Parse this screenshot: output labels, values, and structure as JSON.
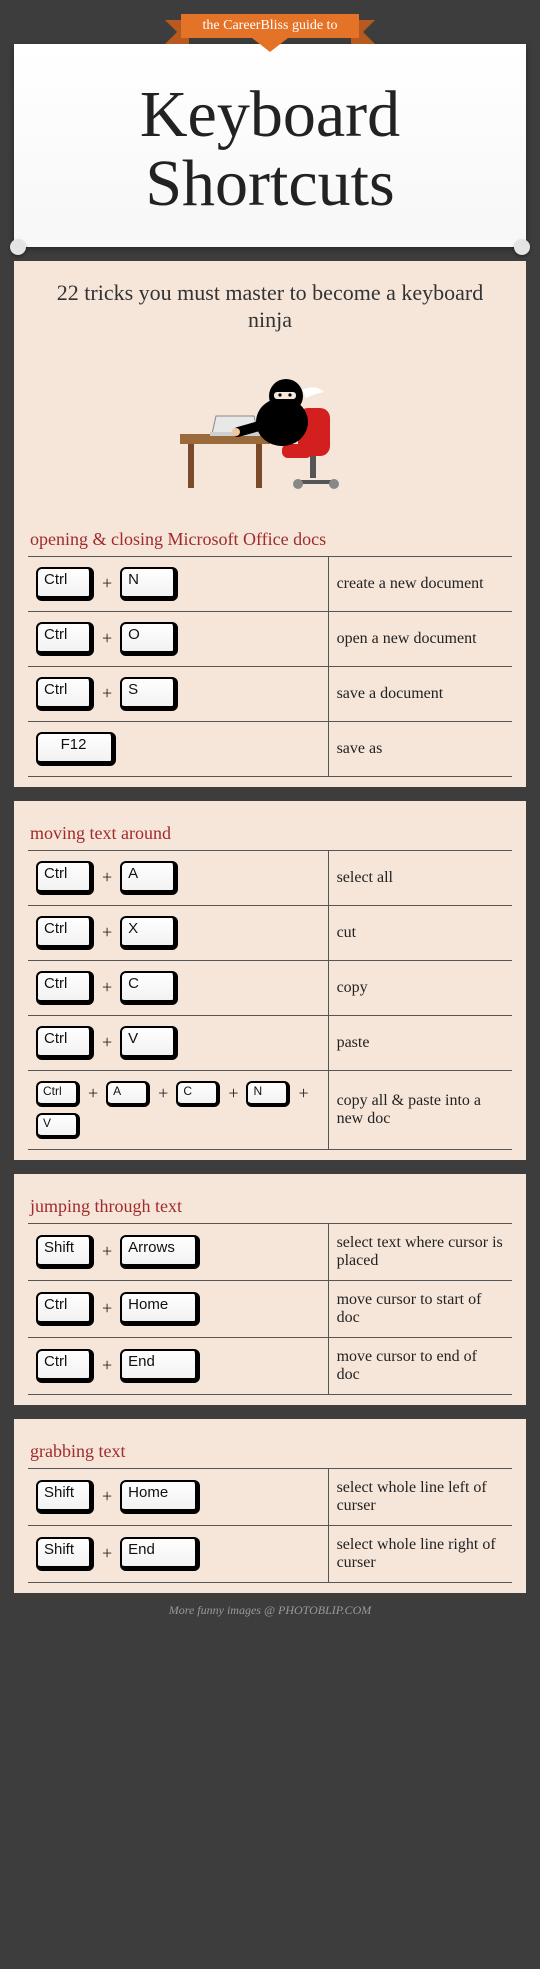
{
  "ribbon": "the CareerBliss guide to",
  "title_l1": "Keyboard",
  "title_l2": "Shortcuts",
  "subtitle": "22 tricks you must master to become a keyboard ninja",
  "sections": [
    {
      "title": "opening & closing Microsoft Office docs",
      "rows": [
        {
          "keys": [
            [
              "Ctrl"
            ],
            "+",
            [
              "N"
            ]
          ],
          "desc": "create a new document"
        },
        {
          "keys": [
            [
              "Ctrl"
            ],
            "+",
            [
              "O"
            ]
          ],
          "desc": "open a new document"
        },
        {
          "keys": [
            [
              "Ctrl"
            ],
            "+",
            [
              "S"
            ]
          ],
          "desc": "save a document"
        },
        {
          "keys": [
            [
              "F12",
              "wide center"
            ]
          ],
          "desc": "save as"
        }
      ]
    },
    {
      "title": "moving text around",
      "rows": [
        {
          "keys": [
            [
              "Ctrl"
            ],
            "+",
            [
              "A"
            ]
          ],
          "desc": "select all"
        },
        {
          "keys": [
            [
              "Ctrl"
            ],
            "+",
            [
              "X"
            ]
          ],
          "desc": "cut"
        },
        {
          "keys": [
            [
              "Ctrl"
            ],
            "+",
            [
              "C"
            ]
          ],
          "desc": "copy"
        },
        {
          "keys": [
            [
              "Ctrl"
            ],
            "+",
            [
              "V"
            ]
          ],
          "desc": "paste"
        },
        {
          "keys": [
            [
              "Ctrl",
              "small"
            ],
            "+",
            [
              "A",
              "small"
            ],
            "+",
            [
              "C",
              "small"
            ],
            "+",
            [
              "N",
              "small"
            ],
            "+",
            [
              "V",
              "small"
            ]
          ],
          "desc": "copy all & paste into a new doc"
        }
      ]
    },
    {
      "title": "jumping through text",
      "rows": [
        {
          "keys": [
            [
              "Shift"
            ],
            "+",
            [
              "Arrows",
              "wide"
            ]
          ],
          "desc": "select text where cursor is placed"
        },
        {
          "keys": [
            [
              "Ctrl"
            ],
            "+",
            [
              "Home",
              "wide"
            ]
          ],
          "desc": "move cursor to start of doc"
        },
        {
          "keys": [
            [
              "Ctrl"
            ],
            "+",
            [
              "End",
              "wide"
            ]
          ],
          "desc": "move cursor to end of doc"
        }
      ]
    },
    {
      "title": "grabbing text",
      "rows": [
        {
          "keys": [
            [
              "Shift"
            ],
            "+",
            [
              "Home",
              "wide"
            ]
          ],
          "desc": "select whole line left of curser"
        },
        {
          "keys": [
            [
              "Shift"
            ],
            "+",
            [
              "End",
              "wide"
            ]
          ],
          "desc": "select whole line right of curser"
        }
      ]
    }
  ],
  "footer": "More funny images @ PHOTOBLIP.COM"
}
